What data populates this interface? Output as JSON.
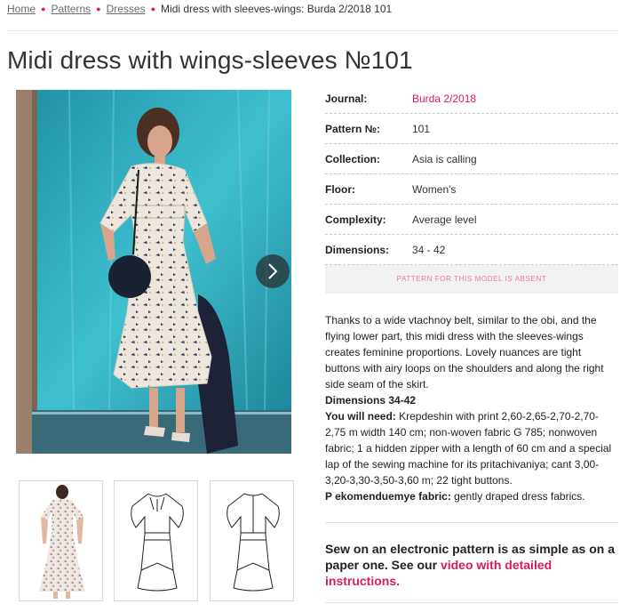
{
  "breadcrumb": {
    "home": "Home",
    "patterns": "Patterns",
    "dresses": "Dresses",
    "current": "Midi dress with sleeves-wings: Burda 2/2018 101"
  },
  "title": "Midi dress with wings-sleeves №101",
  "specs": [
    {
      "label": "Journal:",
      "value": "Burda 2/2018"
    },
    {
      "label": "Pattern №:",
      "value": "101"
    },
    {
      "label": "Collection:",
      "value": "Asia is calling"
    },
    {
      "label": "Floor:",
      "value": "Women's"
    },
    {
      "label": "Complexity:",
      "value": "Average level"
    },
    {
      "label": "Dimensions:",
      "value": "34 - 42"
    }
  ],
  "absent_notice": "PATTERN FOR THIS MODEL IS ABSENT",
  "description": {
    "text": "Thanks to a wide vtachnoy belt, similar to the obi, and the flying lower part, this midi dress with the sleeves-wings creates feminine proportions. Lovely nuances are tight buttons with airy loops on the shoulders and along the right side seam of the skirt.",
    "dimensions": "Dimensions 34-42",
    "need_label": "You will need:",
    "need_text": " Krepdeshin with print 2,60-2,65-2,70-2,70-2,75 m width 140 cm; non-woven fabric G 785; nonwoven fabric; 1 a hidden zipper with a length of 60 cm and a special lap of the sewing machine for its pritachivaniya; cant 3,00-3,20-3,30-3,50-3,60 m; 22 tight buttons.",
    "fabric_label": "P ekomenduemye fabric:",
    "fabric_text": " gently draped dress fabrics."
  },
  "promo": {
    "text": "Sew on an electronic pattern is as simple as on a paper one. See our ",
    "link": "video with detailed instructions."
  },
  "icons": {
    "next": "chevron-right-icon"
  },
  "colors": {
    "accent": "#d81b60",
    "absent_text": "#e8789c"
  }
}
